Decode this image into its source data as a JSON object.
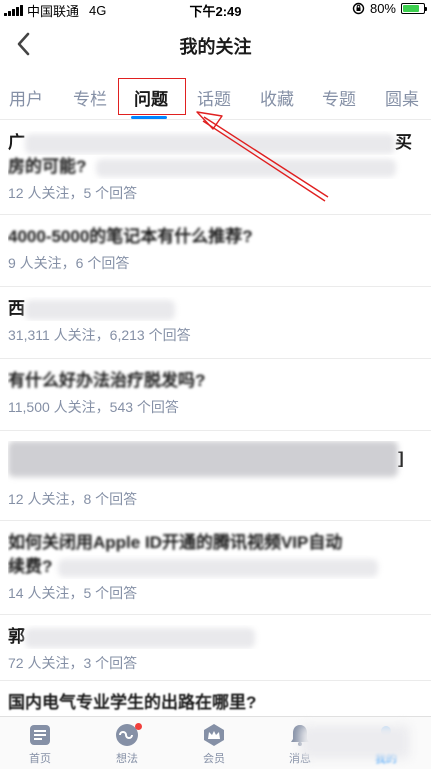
{
  "status_bar": {
    "carrier": "中国联通",
    "network": "4G",
    "time": "下午2:49",
    "battery_percent_label": "80%",
    "battery_level": 0.8
  },
  "header": {
    "title": "我的关注"
  },
  "tabs": [
    {
      "label": "用户",
      "active": false
    },
    {
      "label": "专栏",
      "active": false
    },
    {
      "label": "问题",
      "active": true
    },
    {
      "label": "话题",
      "active": false
    },
    {
      "label": "收藏",
      "active": false
    },
    {
      "label": "专题",
      "active": false
    },
    {
      "label": "圆桌",
      "active": false
    }
  ],
  "questions": [
    {
      "title": "广",
      "title_tail": "买",
      "title_line2": "房的可能?",
      "meta": "12 人关注，5 个回答"
    },
    {
      "title": "4000-5000的笔记本有什么推荐?",
      "meta": "9 人关注，6 个回答"
    },
    {
      "title": "西",
      "meta": "31,311 人关注，6,213 个回答"
    },
    {
      "title": "有什么好办法治疗脱发吗?",
      "meta": "11,500 人关注，543 个回答"
    },
    {
      "title": "",
      "title_tail": "]",
      "meta": "12 人关注，8 个回答"
    },
    {
      "title": "如何关闭用Apple ID开通的腾讯视频VIP自动",
      "title_line2": "续费?",
      "meta": "14 人关注，5 个回答"
    },
    {
      "title": "郭",
      "meta": "72 人关注，3 个回答"
    },
    {
      "title": "国内电气专业学生的出路在哪里?",
      "meta": ""
    }
  ],
  "tabbar": {
    "items": [
      {
        "label": "首页",
        "icon": "home-icon"
      },
      {
        "label": "想法",
        "icon": "ideas-icon",
        "badge": true
      },
      {
        "label": "会员",
        "icon": "crown-icon"
      },
      {
        "label": "消息",
        "icon": "bell-icon"
      },
      {
        "label": "我的",
        "icon": "profile-icon"
      }
    ]
  },
  "colors": {
    "accent": "#0084ff",
    "annotation": "#e02020",
    "muted": "#8590a6"
  }
}
